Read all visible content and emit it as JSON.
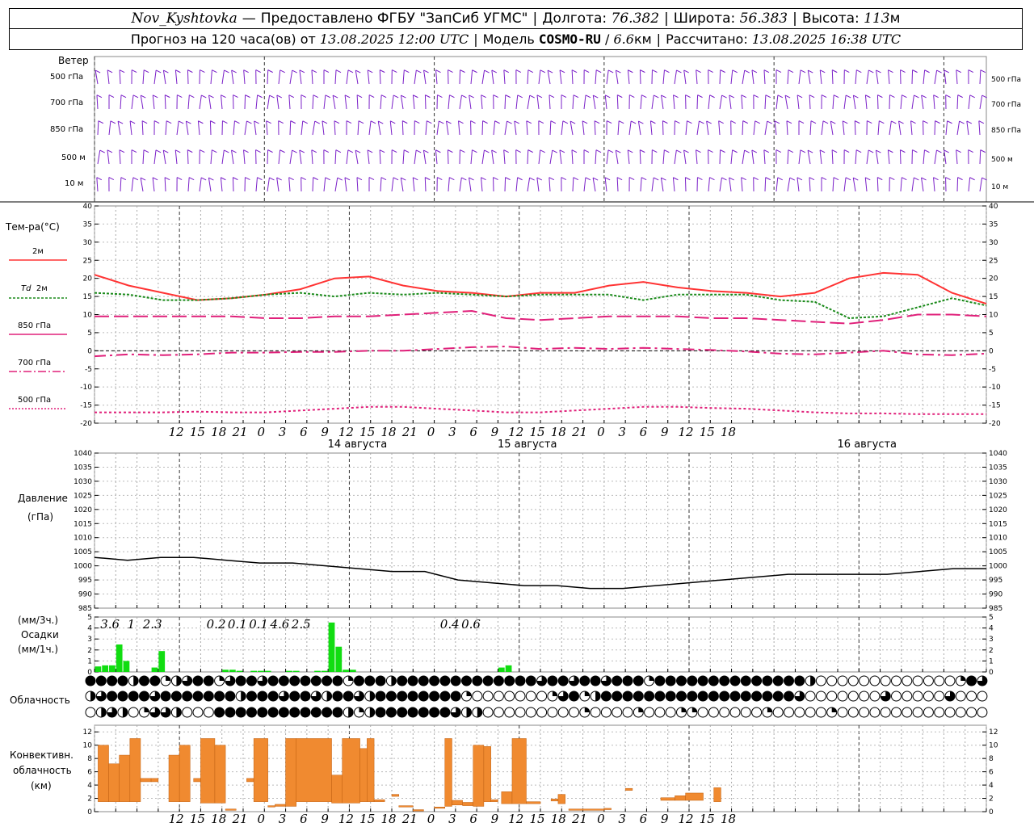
{
  "header": {
    "station": "Nov_Kyshtovka",
    "provider_prefix": "Предоставлено ФГБУ",
    "provider": "\"ЗапСиб УГМС\"",
    "lon_label": "Долгота:",
    "lon": "76.382",
    "lat_label": "Широта:",
    "lat": "56.383",
    "alt_label": "Высота:",
    "alt": "113",
    "alt_unit": "м",
    "forecast_prefix": "Прогноз на 120 часа(ов) от",
    "forecast_time": "13.08.2025 12:00 UTC",
    "model_label": "Модель",
    "model": "COSMO-RU",
    "resolution": "6.6",
    "res_unit": "км",
    "calc_label": "Рассчитано:",
    "calc_time": "13.08.2025 16:38 UTC"
  },
  "labels": {
    "wind": "Ветер",
    "wind_levels": [
      "500 гПа",
      "700 гПа",
      "850 гПа",
      "500 м",
      "10 м"
    ],
    "temp": "Тем-ра(°C)",
    "t2m": "2м",
    "td": "Td",
    "td2m": "2м",
    "t850": "850 гПа",
    "t700": "700 гПа",
    "t500": "500 гПа",
    "pressure": "Давление",
    "pressure_unit": "(гПа)",
    "precip_3h": "(мм/3ч.)",
    "precip": "Осадки",
    "precip_1h": "(мм/1ч.)",
    "cloud": "Облачность",
    "conv1": "Конвективн.",
    "conv2": "облачность",
    "conv3": "(км)"
  },
  "colors": {
    "wind": "#7a1fc8",
    "t2m": "#ff3333",
    "td": "#1a8a1a",
    "t850": "#e0207a",
    "t700": "#e0207a",
    "t500": "#e0207a",
    "pressure": "#000000",
    "precip": "#11dd11",
    "conv": "#f08a30"
  },
  "chart_data": [
    {
      "type": "wind-barbs",
      "levels": [
        "500 гПа",
        "700 гПа",
        "850 гПа",
        "500 м",
        "10 м"
      ]
    },
    {
      "type": "line",
      "ylabel": "Тем-ра(°C)",
      "ylim": [
        -20,
        40
      ],
      "yticks": [
        -20,
        -15,
        -10,
        -5,
        0,
        5,
        10,
        15,
        20,
        25,
        30,
        35,
        40
      ],
      "x_hours": [
        0,
        6,
        12,
        18,
        24,
        30,
        36,
        42,
        48,
        54,
        60,
        66,
        72,
        78,
        84,
        90,
        96,
        102,
        108,
        114,
        120
      ],
      "x_tick_labels": [
        "12",
        "15",
        "18",
        "21",
        "0",
        "3",
        "6",
        "9",
        "12",
        "15",
        "18",
        "21",
        "0",
        "3",
        "6",
        "9",
        "12",
        "15",
        "18",
        "21",
        "0",
        "3",
        "6",
        "9",
        "12",
        "15",
        "18"
      ],
      "day_labels": [
        "14 августа",
        "15 августа",
        "16 августа"
      ],
      "series": [
        {
          "name": "2м",
          "values": [
            21,
            18,
            16,
            14,
            14.5,
            15.5,
            17,
            20,
            20.5,
            18,
            16.5,
            16,
            15,
            16,
            16,
            18,
            19,
            17.5,
            16.5,
            16,
            15,
            16,
            20,
            21.5,
            21,
            16,
            13
          ]
        },
        {
          "name": "Td 2м",
          "values": [
            16,
            15.5,
            14,
            14,
            14.5,
            15.5,
            16,
            15,
            16,
            15.5,
            16,
            15.5,
            15,
            15.5,
            15.5,
            15.5,
            14,
            15.5,
            15.5,
            15.5,
            14,
            13.5,
            9,
            9.5,
            12,
            14.5,
            12.5
          ]
        },
        {
          "name": "850 гПа",
          "values": [
            9.5,
            9.5,
            9.5,
            9.5,
            9.5,
            9,
            9,
            9.5,
            9.5,
            10,
            10.5,
            11,
            9,
            8.5,
            9,
            9.5,
            9.5,
            9.5,
            9,
            9,
            8.5,
            8,
            7.5,
            8.5,
            10,
            10,
            9.5
          ]
        },
        {
          "name": "700 гПа",
          "values": [
            -1.5,
            -1,
            -1.2,
            -1,
            -0.5,
            -0.5,
            -0.3,
            -0.3,
            0,
            0,
            0.5,
            1,
            1.2,
            0.5,
            0.8,
            0.5,
            0.8,
            0.5,
            0.2,
            -0.2,
            -0.8,
            -1,
            -0.5,
            0,
            -1,
            -1.2,
            -0.8
          ]
        },
        {
          "name": "500 гПа",
          "values": [
            -17,
            -17,
            -17,
            -16.8,
            -17,
            -17,
            -16.5,
            -16,
            -15.5,
            -15.5,
            -16,
            -16.5,
            -17,
            -17,
            -16.5,
            -16,
            -15.5,
            -15.5,
            -15.8,
            -16,
            -16.5,
            -17,
            -17.3,
            -17.3,
            -17.5,
            -17.5,
            -17.5
          ]
        }
      ]
    },
    {
      "type": "line",
      "ylabel": "Давление (гПа)",
      "ylim": [
        985,
        1040
      ],
      "yticks": [
        985,
        990,
        995,
        1000,
        1005,
        1010,
        1015,
        1020,
        1025,
        1030,
        1035,
        1040
      ],
      "series": [
        {
          "values": [
            1003,
            1002,
            1003,
            1003,
            1002,
            1001,
            1001,
            1000,
            999,
            998,
            998,
            995,
            994,
            993,
            993,
            992,
            992,
            993,
            994,
            995,
            996,
            997,
            997,
            997,
            997,
            998,
            999,
            999
          ]
        }
      ]
    },
    {
      "type": "bar",
      "ylabel": "Осадки",
      "ylim": [
        0,
        5
      ],
      "yticks": [
        0,
        1,
        2,
        3,
        4,
        5
      ],
      "hourly": [
        {
          "h": 0,
          "v": 0.5
        },
        {
          "h": 1,
          "v": 0.6
        },
        {
          "h": 2,
          "v": 0.6
        },
        {
          "h": 3,
          "v": 2.5
        },
        {
          "h": 4,
          "v": 1
        },
        {
          "h": 8,
          "v": 0.4
        },
        {
          "h": 9,
          "v": 1.9
        },
        {
          "h": 18,
          "v": 0.2
        },
        {
          "h": 19,
          "v": 0.2
        },
        {
          "h": 20,
          "v": 0.1
        },
        {
          "h": 22,
          "v": 0.1
        },
        {
          "h": 23,
          "v": 0.1
        },
        {
          "h": 24,
          "v": 0.1
        },
        {
          "h": 27,
          "v": 0.1
        },
        {
          "h": 28,
          "v": 0.1
        },
        {
          "h": 31,
          "v": 0.1
        },
        {
          "h": 32,
          "v": 0.1
        },
        {
          "h": 33,
          "v": 4.5
        },
        {
          "h": 34,
          "v": 2.3
        },
        {
          "h": 35,
          "v": 0.2
        },
        {
          "h": 36,
          "v": 0.2
        },
        {
          "h": 57,
          "v": 0.4
        },
        {
          "h": 58,
          "v": 0.6
        }
      ],
      "three_hour_totals": [
        {
          "h": 1.5,
          "label": "3.6"
        },
        {
          "h": 4.5,
          "label": "1"
        },
        {
          "h": 7.5,
          "label": "2.3"
        },
        {
          "h": 16.5,
          "label": "0.2"
        },
        {
          "h": 19.5,
          "label": "0.1"
        },
        {
          "h": 22.5,
          "label": "0.1"
        },
        {
          "h": 25.5,
          "label": "4.6"
        },
        {
          "h": 28.5,
          "label": "2.5"
        },
        {
          "h": 49.5,
          "label": "0.4"
        },
        {
          "h": 52.5,
          "label": "0.6"
        }
      ]
    },
    {
      "type": "cloud-symbols",
      "rows": 3,
      "row_cover": [
        [
          4,
          4,
          4,
          4,
          2,
          4,
          4,
          1,
          2,
          3,
          4,
          4,
          1,
          3,
          4,
          4,
          3,
          4,
          4,
          4,
          4,
          4,
          4,
          4,
          1,
          4,
          4,
          4,
          2,
          4,
          4,
          4,
          4,
          4,
          4,
          4,
          4,
          4,
          4,
          4,
          4,
          4,
          3,
          4,
          4,
          3,
          4,
          4,
          3,
          4,
          4,
          4,
          1,
          4,
          4,
          4,
          4,
          4,
          4,
          4,
          4,
          4,
          4,
          4,
          4,
          4,
          4,
          2,
          0,
          0,
          0,
          0,
          0,
          0,
          0,
          0,
          0,
          0,
          0,
          0,
          0,
          1,
          4,
          3
        ],
        [
          2,
          3,
          4,
          4,
          4,
          4,
          3,
          4,
          4,
          4,
          4,
          4,
          4,
          4,
          2,
          4,
          4,
          4,
          3,
          4,
          4,
          3,
          2,
          4,
          4,
          3,
          2,
          4,
          4,
          4,
          4,
          4,
          4,
          4,
          4,
          1,
          0,
          0,
          0,
          0,
          0,
          0,
          0,
          1,
          3,
          4,
          1,
          2,
          4,
          4,
          4,
          4,
          4,
          4,
          4,
          4,
          4,
          4,
          4,
          4,
          4,
          4,
          4,
          4,
          4,
          4,
          3,
          0,
          0,
          0,
          0,
          0,
          0,
          0,
          3,
          0,
          0,
          0,
          0,
          0,
          3,
          0,
          0,
          0
        ],
        [
          0,
          2,
          3,
          2,
          0,
          1,
          3,
          3,
          2,
          0,
          0,
          0,
          4,
          4,
          4,
          4,
          4,
          4,
          4,
          4,
          4,
          4,
          4,
          4,
          2,
          1,
          2,
          4,
          4,
          4,
          4,
          4,
          4,
          4,
          3,
          2,
          2,
          0,
          0,
          0,
          0,
          0,
          0,
          0,
          0,
          0,
          1,
          0,
          0,
          0,
          0,
          1,
          0,
          0,
          0,
          1,
          1,
          0,
          0,
          0,
          0,
          0,
          0,
          1,
          0,
          0,
          0,
          0,
          0,
          1,
          0,
          0,
          0,
          0,
          0,
          0,
          0,
          0,
          0,
          0,
          0,
          0,
          0,
          0
        ]
      ]
    },
    {
      "type": "bar",
      "ylabel": "Конвективн. облачность (км)",
      "ylim": [
        0,
        13
      ],
      "yticks": [
        0,
        2,
        4,
        6,
        8,
        10,
        12
      ],
      "segments": [
        {
          "h0": 0.5,
          "h1": 2,
          "bot": 1.5,
          "top": 10
        },
        {
          "h0": 2,
          "h1": 3.5,
          "bot": 1.5,
          "top": 7.2
        },
        {
          "h0": 3.5,
          "h1": 5,
          "bot": 1.5,
          "top": 8.5
        },
        {
          "h0": 5,
          "h1": 6.5,
          "bot": 1.5,
          "top": 11
        },
        {
          "h0": 6.5,
          "h1": 8,
          "bot": 4.5,
          "top": 5
        },
        {
          "h0": 8,
          "h1": 9,
          "bot": 4.5,
          "top": 5
        },
        {
          "h0": 10.5,
          "h1": 12,
          "bot": 1.5,
          "top": 8.5
        },
        {
          "h0": 12,
          "h1": 13.5,
          "bot": 1.5,
          "top": 10
        },
        {
          "h0": 14,
          "h1": 15,
          "bot": 4.5,
          "top": 5
        },
        {
          "h0": 15,
          "h1": 17,
          "bot": 1.3,
          "top": 11
        },
        {
          "h0": 17,
          "h1": 18.5,
          "bot": 1.3,
          "top": 10
        },
        {
          "h0": 18.5,
          "h1": 20,
          "bot": 0.2,
          "top": 0.4
        },
        {
          "h0": 21.5,
          "h1": 22.5,
          "bot": 4.5,
          "top": 5
        },
        {
          "h0": 22.5,
          "h1": 24.5,
          "bot": 1.5,
          "top": 11
        },
        {
          "h0": 24.5,
          "h1": 25.5,
          "bot": 0.7,
          "top": 0.9
        },
        {
          "h0": 25.5,
          "h1": 27,
          "bot": 0.8,
          "top": 1.1
        },
        {
          "h0": 27,
          "h1": 28.5,
          "bot": 0.8,
          "top": 11
        },
        {
          "h0": 28.5,
          "h1": 33.5,
          "bot": 1.5,
          "top": 11
        },
        {
          "h0": 33.5,
          "h1": 35,
          "bot": 1.3,
          "top": 5.5
        },
        {
          "h0": 35,
          "h1": 37.5,
          "bot": 1.3,
          "top": 11
        },
        {
          "h0": 37.5,
          "h1": 38.5,
          "bot": 1.5,
          "top": 9.5
        },
        {
          "h0": 38.5,
          "h1": 39.5,
          "bot": 1.5,
          "top": 11
        },
        {
          "h0": 39.5,
          "h1": 41,
          "bot": 1.5,
          "top": 1.8
        },
        {
          "h0": 42,
          "h1": 43,
          "bot": 2.3,
          "top": 2.6
        },
        {
          "h0": 43,
          "h1": 45,
          "bot": 0.7,
          "top": 0.9
        },
        {
          "h0": 45,
          "h1": 46.5,
          "bot": 0.1,
          "top": 0.3
        },
        {
          "h0": 48,
          "h1": 49.5,
          "bot": 0.5,
          "top": 0.7
        },
        {
          "h0": 49.5,
          "h1": 50.5,
          "bot": 0.8,
          "top": 11
        },
        {
          "h0": 50.5,
          "h1": 52,
          "bot": 1,
          "top": 1.7
        },
        {
          "h0": 52,
          "h1": 53.5,
          "bot": 0.9,
          "top": 1.4
        },
        {
          "h0": 53.5,
          "h1": 55,
          "bot": 0.8,
          "top": 10
        },
        {
          "h0": 55,
          "h1": 56,
          "bot": 1.5,
          "top": 9.8
        },
        {
          "h0": 56,
          "h1": 57,
          "bot": 1.5,
          "top": 1.8
        },
        {
          "h0": 57.5,
          "h1": 59,
          "bot": 1.2,
          "top": 3
        },
        {
          "h0": 59,
          "h1": 61,
          "bot": 1.2,
          "top": 11
        },
        {
          "h0": 61,
          "h1": 63,
          "bot": 1.2,
          "top": 1.5
        },
        {
          "h0": 64.5,
          "h1": 65.5,
          "bot": 1.6,
          "top": 1.9
        },
        {
          "h0": 65.5,
          "h1": 66.5,
          "bot": 1.2,
          "top": 2.6
        },
        {
          "h0": 67,
          "h1": 72,
          "bot": 0.2,
          "top": 0.4
        },
        {
          "h0": 72,
          "h1": 73,
          "bot": 0.3,
          "top": 0.5
        },
        {
          "h0": 75,
          "h1": 76,
          "bot": 3.2,
          "top": 3.5
        },
        {
          "h0": 80,
          "h1": 82,
          "bot": 1.7,
          "top": 2.1
        },
        {
          "h0": 82,
          "h1": 83.5,
          "bot": 1.7,
          "top": 2.4
        },
        {
          "h0": 83.5,
          "h1": 86,
          "bot": 1.7,
          "top": 2.8
        },
        {
          "h0": 87.5,
          "h1": 88.5,
          "bot": 1.5,
          "top": 3.6
        }
      ]
    }
  ]
}
